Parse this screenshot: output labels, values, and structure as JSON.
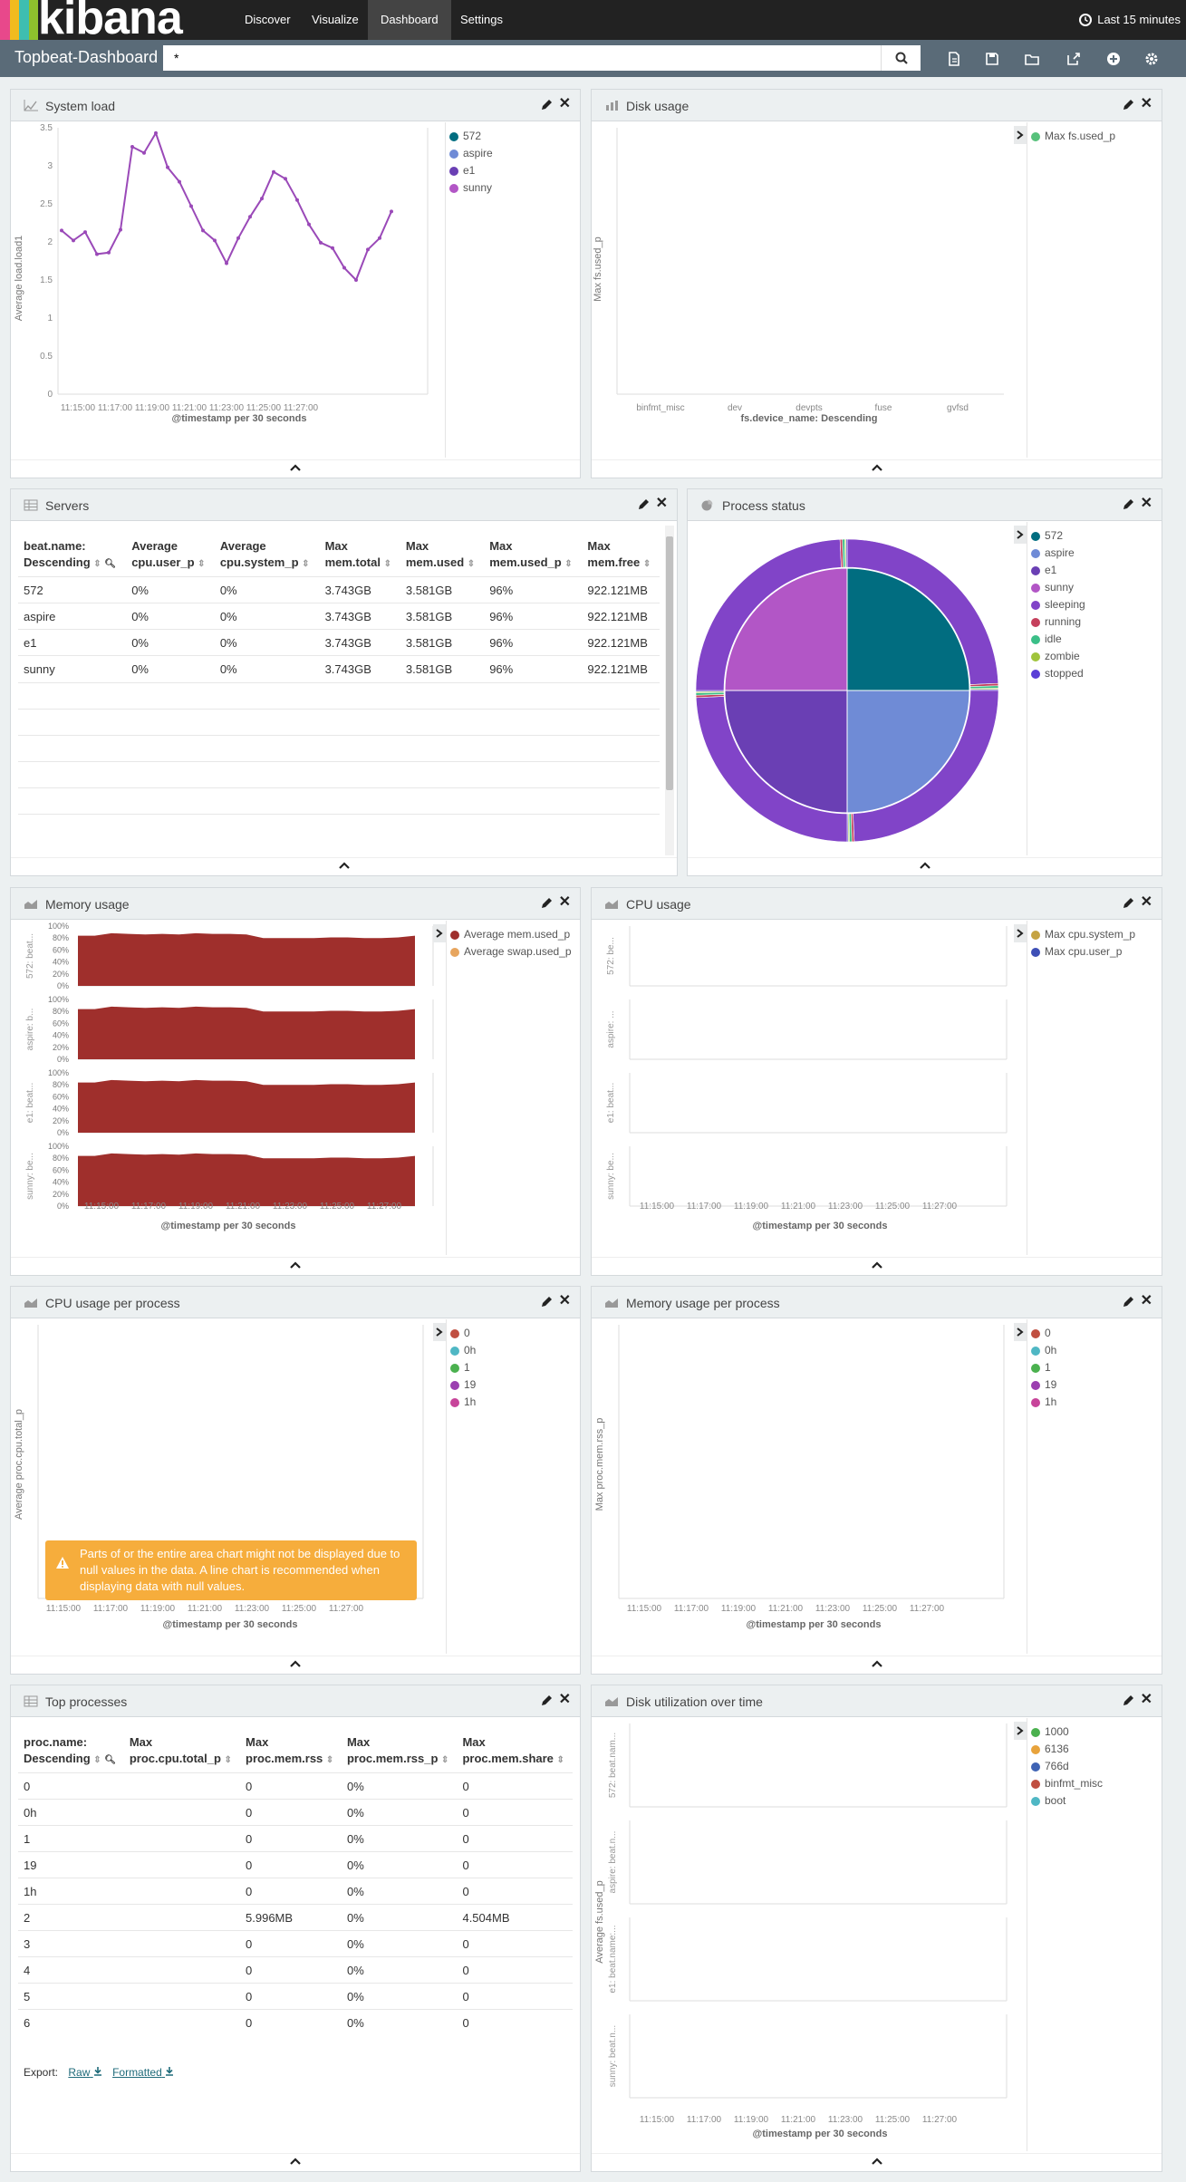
{
  "nav": {
    "logo": "kibana",
    "links": [
      "Discover",
      "Visualize",
      "Dashboard",
      "Settings"
    ],
    "active": "Dashboard",
    "time": "Last 15 minutes"
  },
  "toolbar": {
    "title": "Topbeat-Dashboard",
    "query": "*",
    "icons": [
      "new-dashboard-icon",
      "save-icon",
      "open-icon",
      "share-icon",
      "add-visualization-icon",
      "settings-icon"
    ]
  },
  "colors": {
    "host_572": "#016d80",
    "host_aspire": "#6f8bd6",
    "host_e1": "#6a3fb4",
    "host_sunny": "#b256c6",
    "mem": "#9f2f2c",
    "swap": "#e7a55e",
    "line": "#9a49b8",
    "warn": "#f6ad3c"
  },
  "panels": {
    "system_load": {
      "title": "System load",
      "legend": [
        "572",
        "aspire",
        "e1",
        "sunny"
      ]
    },
    "disk_usage": {
      "title": "Disk usage",
      "legend": [
        "Max fs.used_p"
      ]
    },
    "servers": {
      "title": "Servers",
      "columns": [
        [
          "beat.name:",
          "Descending"
        ],
        [
          "Average",
          "cpu.user_p"
        ],
        [
          "Average",
          "cpu.system_p"
        ],
        [
          "Max",
          "mem.total"
        ],
        [
          "Max",
          "mem.used"
        ],
        [
          "Max",
          "mem.used_p"
        ],
        [
          "Max",
          "mem.free"
        ]
      ],
      "rows": [
        [
          "572",
          "0%",
          "0%",
          "3.743GB",
          "3.581GB",
          "96%",
          "922.121MB"
        ],
        [
          "aspire",
          "0%",
          "0%",
          "3.743GB",
          "3.581GB",
          "96%",
          "922.121MB"
        ],
        [
          "e1",
          "0%",
          "0%",
          "3.743GB",
          "3.581GB",
          "96%",
          "922.121MB"
        ],
        [
          "sunny",
          "0%",
          "0%",
          "3.743GB",
          "3.581GB",
          "96%",
          "922.121MB"
        ]
      ]
    },
    "process_status": {
      "title": "Process status",
      "legend": [
        "572",
        "aspire",
        "e1",
        "sunny",
        "sleeping",
        "running",
        "idle",
        "zombie",
        "stopped"
      ]
    },
    "memory_usage": {
      "title": "Memory usage",
      "legend": [
        "Average mem.used_p",
        "Average swap.used_p"
      ],
      "row_labels": [
        "572: beat...",
        "aspire: b...",
        "e1: beat...",
        "sunny: be..."
      ],
      "yticks": [
        "100%",
        "80%",
        "60%",
        "40%",
        "20%",
        "0%"
      ]
    },
    "cpu_usage": {
      "title": "CPU usage",
      "legend": [
        "Max cpu.system_p",
        "Max cpu.user_p"
      ],
      "row_labels": [
        "572: be...",
        "aspire: ...",
        "e1: beat...",
        "sunny: be..."
      ]
    },
    "cpu_per_process": {
      "title": "CPU usage per process",
      "legend": [
        "0",
        "0h",
        "1",
        "19",
        "1h"
      ],
      "ylabel": "Average proc.cpu.total_p",
      "warning": "Parts of or the entire area chart might not be displayed due to null values in the data. A line chart is recommended when displaying data with null values."
    },
    "mem_per_process": {
      "title": "Memory usage per process",
      "legend": [
        "0",
        "0h",
        "1",
        "19",
        "1h"
      ],
      "ylabel": "Max proc.mem.rss_p"
    },
    "top_processes": {
      "title": "Top processes",
      "columns": [
        [
          "proc.name:",
          "Descending"
        ],
        [
          "Max",
          "proc.cpu.total_p"
        ],
        [
          "Max",
          "proc.mem.rss"
        ],
        [
          "Max",
          "proc.mem.rss_p"
        ],
        [
          "Max",
          "proc.mem.share"
        ]
      ],
      "rows": [
        [
          "0",
          "",
          "0",
          "0%",
          "0"
        ],
        [
          "0h",
          "",
          "0",
          "0%",
          "0"
        ],
        [
          "1",
          "",
          "0",
          "0%",
          "0"
        ],
        [
          "19",
          "",
          "0",
          "0%",
          "0"
        ],
        [
          "1h",
          "",
          "0",
          "0%",
          "0"
        ],
        [
          "2",
          "",
          "5.996MB",
          "0%",
          "4.504MB"
        ],
        [
          "3",
          "",
          "0",
          "0%",
          "0"
        ],
        [
          "4",
          "",
          "0",
          "0%",
          "0"
        ],
        [
          "5",
          "",
          "0",
          "0%",
          "0"
        ],
        [
          "6",
          "",
          "0",
          "0%",
          "0"
        ]
      ],
      "export_label": "Export:",
      "export_raw": "Raw",
      "export_formatted": "Formatted"
    },
    "disk_util": {
      "title": "Disk utilization over time",
      "legend": [
        "1000",
        "6136",
        "766d",
        "binfmt_misc",
        "boot"
      ],
      "ylabel": "Average fs.used_p",
      "row_labels": [
        "572: beat.nam...",
        "aspire: beat.n...",
        "e1: beat.name:...",
        "sunny: beat.n..."
      ]
    }
  },
  "time_ticks": [
    "11:15:00",
    "11:17:00",
    "11:19:00",
    "11:21:00",
    "11:23:00",
    "11:25:00",
    "11:27:00"
  ],
  "xlabel_time": "@timestamp per 30 seconds",
  "chart_data": [
    {
      "type": "line",
      "title": "System load",
      "ylabel": "Average load.load1",
      "xlabel": "@timestamp per 30 seconds",
      "ylim": [
        0,
        3.5
      ],
      "yticks": [
        0,
        0.5,
        1,
        1.5,
        2,
        2.5,
        3,
        3.5
      ],
      "x": [
        "11:14:30",
        "11:15:00",
        "11:15:30",
        "11:16:00",
        "11:16:30",
        "11:17:00",
        "11:17:30",
        "11:18:00",
        "11:18:30",
        "11:19:00",
        "11:19:30",
        "11:20:00",
        "11:20:30",
        "11:21:00",
        "11:21:30",
        "11:22:00",
        "11:22:30",
        "11:23:00",
        "11:23:30",
        "11:24:00",
        "11:24:30",
        "11:25:00",
        "11:25:30",
        "11:26:00",
        "11:26:30",
        "11:27:00",
        "11:27:30",
        "11:28:00",
        "11:28:30"
      ],
      "values": [
        2.15,
        2.02,
        2.13,
        1.84,
        1.86,
        2.16,
        3.25,
        3.17,
        3.43,
        2.98,
        2.79,
        2.47,
        2.15,
        2.02,
        1.72,
        2.05,
        2.33,
        2.57,
        2.92,
        2.83,
        2.55,
        2.23,
        1.99,
        1.92,
        1.66,
        1.5,
        1.9,
        2.05,
        2.4
      ]
    },
    {
      "type": "bar",
      "title": "Disk usage",
      "ylabel": "Max fs.used_p",
      "xlabel": "fs.device_name: Descending",
      "categories": [
        "binfmt_misc",
        "dev",
        "devpts",
        "fuse",
        "gvfsd"
      ],
      "values": [
        0,
        0,
        0,
        0,
        0
      ]
    },
    {
      "type": "pie",
      "title": "Process status",
      "inner": [
        {
          "label": "572",
          "value": 25
        },
        {
          "label": "aspire",
          "value": 25
        },
        {
          "label": "e1",
          "value": 25
        },
        {
          "label": "sunny",
          "value": 25
        }
      ],
      "outer_each": [
        {
          "label": "sleeping",
          "value": 97
        },
        {
          "label": "running",
          "value": 1
        },
        {
          "label": "idle",
          "value": 1
        },
        {
          "label": "zombie",
          "value": 0.5
        },
        {
          "label": "stopped",
          "value": 0.5
        }
      ]
    },
    {
      "type": "area",
      "title": "Memory usage",
      "ylim": [
        0,
        100
      ],
      "series": [
        {
          "name": "Average mem.used_p",
          "values": [
            84,
            84,
            88,
            87,
            86,
            87,
            86,
            88,
            87,
            87,
            86,
            80,
            80,
            80,
            80,
            81,
            81,
            80,
            80,
            81,
            84
          ]
        },
        {
          "name": "Average swap.used_p",
          "values": [
            0,
            0,
            0,
            0,
            0,
            0,
            0,
            0,
            0,
            0,
            0,
            0,
            0,
            0,
            0,
            0,
            0,
            0,
            0,
            0,
            0
          ]
        }
      ]
    }
  ]
}
